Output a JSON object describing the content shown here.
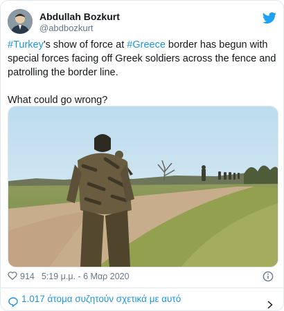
{
  "tweet": {
    "author": {
      "name": "Abdullah Bozkurt",
      "handle": "@abdbozkurt"
    },
    "text": {
      "hashtag_1": "#Turkey",
      "part_1": "'s show of force at ",
      "hashtag_2": "#Greece",
      "part_2": " border has begun with special forces facing off Greek soldiers across the fence and patrolling the border line.",
      "line_2": "What could go wrong?"
    },
    "meta": {
      "likes": "914",
      "timestamp": "5:19 μ.μ. - 6 Μαρ 2020"
    },
    "replies_link": "1.017 άτομα συζητούν σχετικά με αυτό"
  },
  "colors": {
    "brand_blue": "#1da1f2",
    "link_blue": "#1b95e0",
    "secondary_text": "#657786",
    "border": "#e1e8ed"
  },
  "icons": {
    "brand": "twitter-bird-icon",
    "likes": "heart-outline-icon",
    "info": "info-circle-icon",
    "replies": "speech-bubble-icon",
    "chevron": "chevron-right-icon"
  }
}
